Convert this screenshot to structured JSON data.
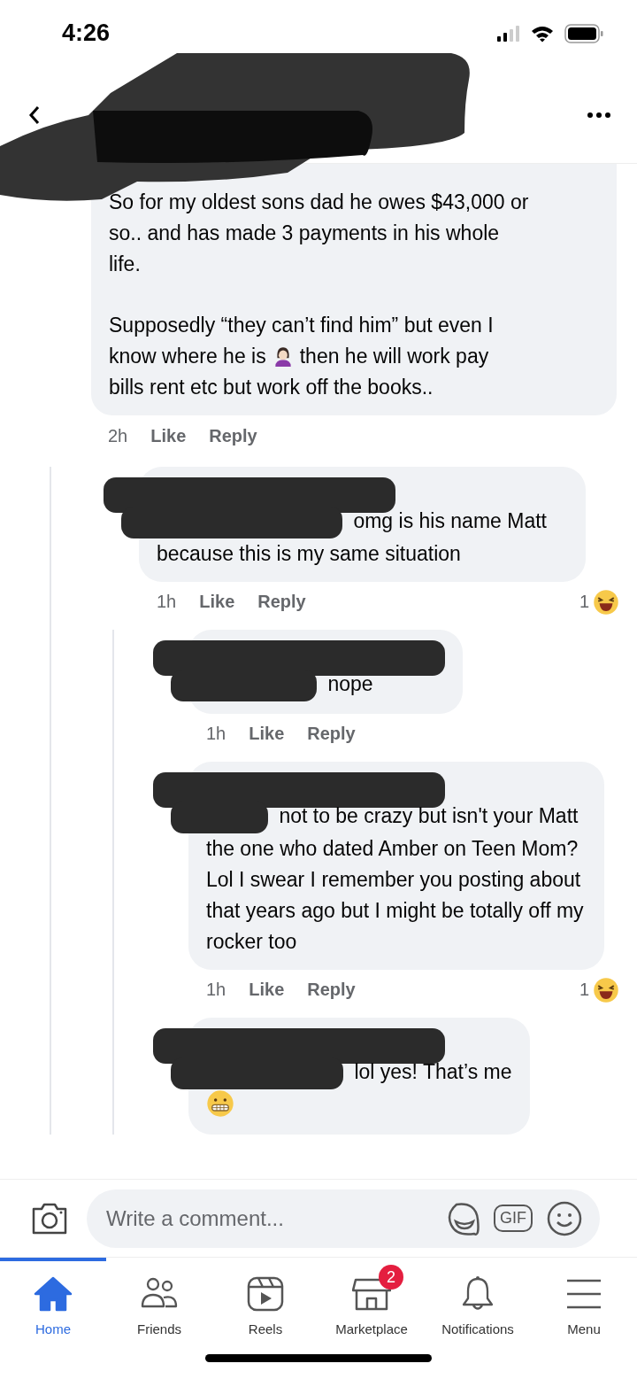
{
  "status_bar": {
    "time": "4:26"
  },
  "header": {
    "title_redacted": true
  },
  "comments": [
    {
      "parts": [
        {
          "kind": "text",
          "text": "So for my oldest sons dad he owes $43,000 or"
        },
        {
          "kind": "newline"
        },
        {
          "kind": "text",
          "text": "so.. and has made 3 payments in his whole"
        },
        {
          "kind": "newline"
        },
        {
          "kind": "text",
          "text": "life."
        },
        {
          "kind": "gap"
        },
        {
          "kind": "text",
          "text": "Supposedly “they can’t find him” but even I"
        },
        {
          "kind": "newline"
        },
        {
          "kind": "text",
          "text": "know where he is"
        },
        {
          "kind": "facepalm"
        },
        {
          "kind": "text",
          "text": "then he will work pay"
        },
        {
          "kind": "newline"
        },
        {
          "kind": "text",
          "text": "bills rent etc but work off the books.."
        }
      ],
      "time": "2h",
      "like": "Like",
      "reply": "Reply",
      "children": [
        {
          "name_redacted": true,
          "mention_redacted": true,
          "parts": [
            {
              "kind": "text",
              "text": "omg is his name Matt because this is my same situation"
            }
          ],
          "time": "1h",
          "like": "Like",
          "reply": "Reply",
          "reaction_count": "1",
          "children": [
            {
              "name_redacted": true,
              "mention_redacted": true,
              "parts": [
                {
                  "kind": "text",
                  "text": "nope"
                }
              ],
              "time": "1h",
              "like": "Like",
              "reply": "Reply"
            },
            {
              "name_redacted": true,
              "mention_redacted": true,
              "parts": [
                {
                  "kind": "text",
                  "text": "not to be crazy but isn't your Matt the one who dated Amber on Teen Mom? Lol I swear I remember you posting about that years ago but I might be totally off my rocker too"
                }
              ],
              "time": "1h",
              "like": "Like",
              "reply": "Reply",
              "reaction_count": "1"
            },
            {
              "name_redacted": true,
              "mention_redacted": true,
              "parts": [
                {
                  "kind": "text",
                  "text": "lol yes! That’s me"
                },
                {
                  "kind": "newline"
                },
                {
                  "kind": "grimace"
                }
              ]
            }
          ]
        }
      ]
    }
  ],
  "composer": {
    "placeholder": "Write a comment...",
    "gif_label": "GIF"
  },
  "tabs": [
    {
      "label": "Home",
      "selected": true
    },
    {
      "label": "Friends",
      "selected": false
    },
    {
      "label": "Reels",
      "selected": false
    },
    {
      "label": "Marketplace",
      "selected": false,
      "badge": "2"
    },
    {
      "label": "Notifications",
      "selected": false
    },
    {
      "label": "Menu",
      "selected": false
    }
  ]
}
